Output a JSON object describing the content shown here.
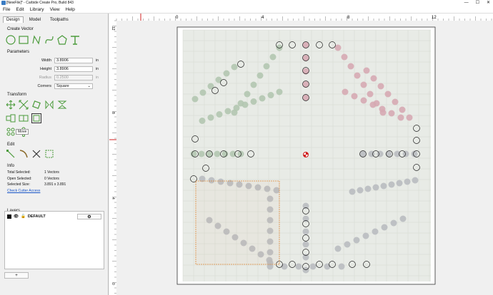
{
  "window": {
    "title": "[NewFile]* - Carbide Create Pro, Build 843",
    "minimize": "—",
    "maximize": "☐",
    "close": "✕"
  },
  "menu": [
    "File",
    "Edit",
    "Library",
    "View",
    "Help"
  ],
  "tabs": [
    "Design",
    "Model",
    "Toolpaths"
  ],
  "sections": {
    "create_vector": "Create Vector",
    "parameters": "Parameters",
    "transform": "Transform",
    "edit": "Edit",
    "info": "Info",
    "layers": "Layers"
  },
  "parameters": {
    "width_label": "Width",
    "width_value": "3.8906",
    "width_unit": "in",
    "height_label": "Height",
    "height_value": "3.8906",
    "height_unit": "in",
    "radius_label": "Radius",
    "radius_value": "0.2500",
    "radius_unit": "in",
    "corners_label": "Corners",
    "corners_value": "Square"
  },
  "tooltip": "Move",
  "info": {
    "total_selected_label": "Total Selected:",
    "total_selected_value": "1 Vectors",
    "open_selected_label": "Open Selected:",
    "open_selected_value": "0 Vectors",
    "selected_size_label": "Selected Size:",
    "selected_size_value": "3.891 x 3.891",
    "check_link": "Check Cutter Access"
  },
  "layers": {
    "default_name": "DEFAULT",
    "gear": "⚙",
    "add": "+"
  },
  "ruler": {
    "h_labels": [
      "0",
      "4",
      "8",
      "12"
    ],
    "v_labels": [
      "12",
      "8",
      "4",
      "0"
    ]
  },
  "colors": {
    "accent_green": "#4a9a3a",
    "selection_orange": "#e08a3a",
    "origin_red": "#d02020"
  }
}
